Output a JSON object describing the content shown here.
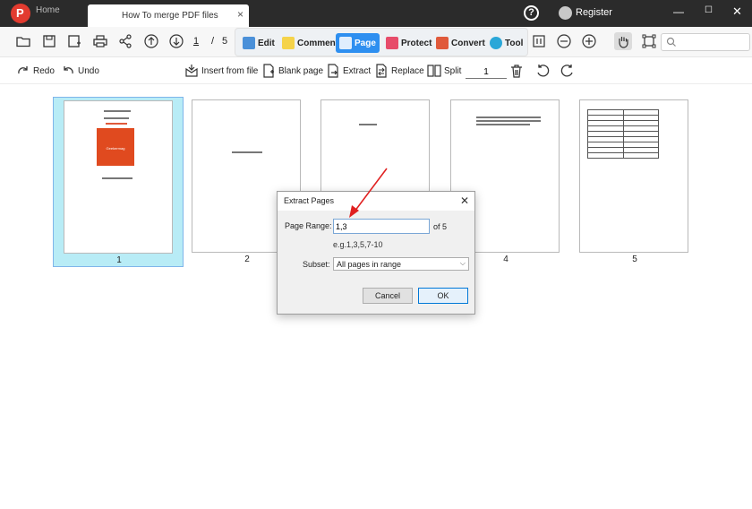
{
  "titlebar": {
    "logo_letter": "P",
    "home_tab": "Home",
    "doc_tab_title": "How To merge PDF files",
    "tab_close": "×",
    "help": "?",
    "register": "Register",
    "minimize": "—",
    "maximize": "☐",
    "close": "✕"
  },
  "toolbar": {
    "current_page": "1",
    "separator": "/",
    "total_pages": "5",
    "modes": [
      {
        "label": "Edit",
        "icon": "edit-icon"
      },
      {
        "label": "Comment",
        "icon": "comment-icon"
      },
      {
        "label": "Page",
        "icon": "page-icon"
      },
      {
        "label": "Protect",
        "icon": "protect-icon"
      },
      {
        "label": "Convert",
        "icon": "convert-icon"
      },
      {
        "label": "Tool",
        "icon": "tool-icon"
      }
    ],
    "active_mode": "Page",
    "accent_color": "#2e8ff0",
    "search_placeholder": ""
  },
  "page_toolbar": {
    "redo": "Redo",
    "undo": "Undo",
    "insert_from_file": "Insert from file",
    "blank_page": "Blank page",
    "extract": "Extract",
    "replace": "Replace",
    "split": "Split",
    "split_value": "1"
  },
  "thumbnails": [
    {
      "label": "1",
      "selected": true
    },
    {
      "label": "2",
      "selected": false
    },
    {
      "label": "3",
      "selected": false
    },
    {
      "label": "4",
      "selected": false
    },
    {
      "label": "5",
      "selected": false
    }
  ],
  "cover_text": "Geekermag",
  "dialog": {
    "title": "Extract Pages",
    "close": "✕",
    "page_range_label": "Page Range:",
    "page_range_value": "1,3",
    "of_total": "of 5",
    "hint": "e.g.1,3,5,7-10",
    "subset_label": "Subset:",
    "subset_value": "All pages in range",
    "subset_arrow": "⌵",
    "cancel": "Cancel",
    "ok": "OK"
  }
}
